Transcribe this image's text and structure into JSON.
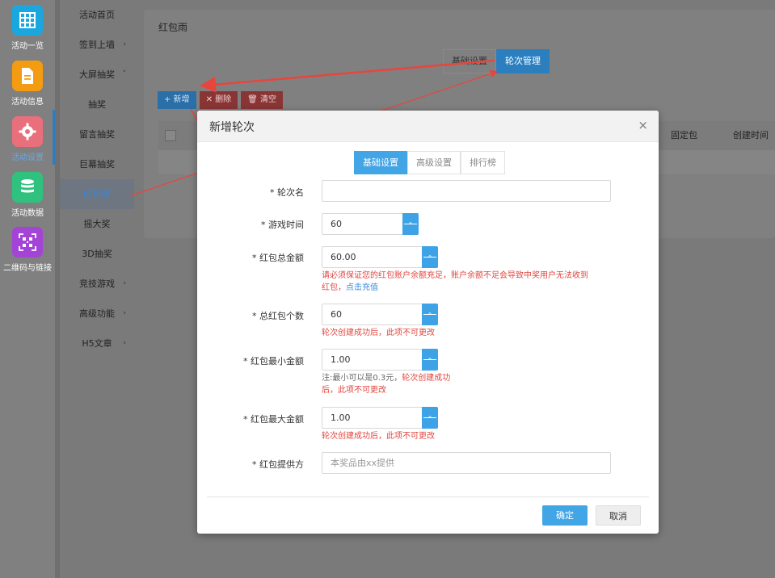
{
  "rail": {
    "items": [
      {
        "label": "活动一览",
        "icon": "grid-icon",
        "color": "#1aa7e0"
      },
      {
        "label": "活动信息",
        "icon": "document-icon",
        "color": "#f39c12"
      },
      {
        "label": "活动设置",
        "icon": "gear-icon",
        "color": "#e96f7c"
      },
      {
        "label": "活动数据",
        "icon": "database-icon",
        "color": "#2ec27e"
      },
      {
        "label": "二维码与链接",
        "icon": "qrcode-icon",
        "color": "#a444d6"
      }
    ]
  },
  "submenu": {
    "items": [
      {
        "label": "活动首页",
        "arrow": ""
      },
      {
        "label": "签到上墙",
        "arrow": "›"
      },
      {
        "label": "大屏抽奖",
        "arrow": "˅"
      },
      {
        "label": "抽奖",
        "arrow": ""
      },
      {
        "label": "留言抽奖",
        "arrow": ""
      },
      {
        "label": "巨幕抽奖",
        "arrow": ""
      },
      {
        "label": "红包雨",
        "arrow": ""
      },
      {
        "label": "摇大奖",
        "arrow": ""
      },
      {
        "label": "3D抽奖",
        "arrow": ""
      },
      {
        "label": "竞技游戏",
        "arrow": "›"
      },
      {
        "label": "高级功能",
        "arrow": "›"
      },
      {
        "label": "H5文章",
        "arrow": "›"
      }
    ]
  },
  "page": {
    "breadcrumb": "红包雨",
    "tabs": [
      "基础设置",
      "轮次管理"
    ],
    "toolbar": {
      "add": "+ 新增",
      "delete": "✕ 删除",
      "clear": "🗑 清空"
    },
    "grid_columns": [
      "固定包",
      "创建时间"
    ]
  },
  "modal": {
    "title": "新增轮次",
    "close": "×",
    "tabs": [
      "基础设置",
      "高级设置",
      "排行榜"
    ],
    "fields": {
      "round_name": {
        "label": "* 轮次名",
        "value": ""
      },
      "game_time": {
        "label": "* 游戏时间",
        "value": "60"
      },
      "total_amount": {
        "label": "* 红包总金额",
        "value": "60.00"
      },
      "total_amount_hint_1": "请必须保证您的红包账户余额充足，账户余额不足会导致中奖用户无法收到",
      "total_amount_hint_2": "红包，",
      "total_amount_hint_link": "点击充值",
      "count": {
        "label": "* 总红包个数",
        "value": "60"
      },
      "count_hint": "轮次创建成功后，此项不可更改",
      "min_amount": {
        "label": "* 红包最小金额",
        "value": "1.00"
      },
      "min_hint_gray": "注:最小可以是0.3元，",
      "min_hint_red1": "轮次创建成功",
      "min_hint_red2": "后，此项不可更改",
      "max_amount": {
        "label": "* 红包最大金额",
        "value": "1.00"
      },
      "max_hint": "轮次创建成功后，此项不可更改",
      "provider": {
        "label": "* 红包提供方",
        "placeholder": "本奖品由xx提供"
      }
    },
    "ok": "确定",
    "cancel": "取消"
  },
  "colors": {
    "accent": "#42a5e6",
    "error": "#e0463f",
    "annotation": "#e8453c"
  }
}
